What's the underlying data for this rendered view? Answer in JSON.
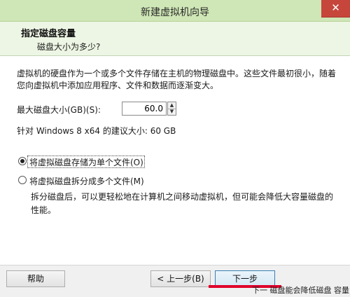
{
  "window": {
    "title": "新建虚拟机向导",
    "close_glyph": "✕"
  },
  "header": {
    "title": "指定磁盘容量",
    "subtitle": "磁盘大小为多少?"
  },
  "body": {
    "description": "虚拟机的硬盘作为一个或多个文件存储在主机的物理磁盘中。这些文件最初很小，随着您向虚拟机中添加应用程序、文件和数据而逐渐变大。",
    "max_size_label": "最大磁盘大小(GB)(S):",
    "max_size_value": "60.0",
    "recommend_text": "针对 Windows 8 x64 的建议大小: 60 GB",
    "options": [
      {
        "label": "将虚拟磁盘存储为单个文件(O)",
        "checked": true
      },
      {
        "label": "将虚拟磁盘拆分成多个文件(M)",
        "checked": false
      }
    ],
    "split_hint": "拆分磁盘后，可以更轻松地在计算机之间移动虚拟机，但可能会降低大容量磁盘的性能。"
  },
  "footer": {
    "help": "帮助",
    "back": "< 上一步(B)",
    "next": "下一步"
  },
  "overlay": {
    "annotation_text": "下一  磁盘能会降低磁盘 容量"
  }
}
